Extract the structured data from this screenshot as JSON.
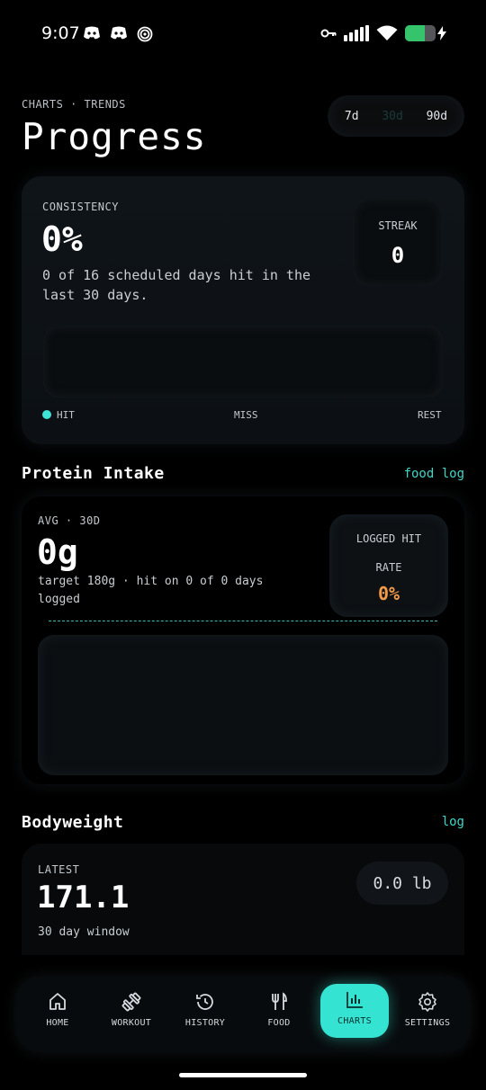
{
  "status_bar": {
    "time": "9:07",
    "left_icons": [
      "discord-icon",
      "discord-icon",
      "spiral-app-icon"
    ],
    "right_icons": [
      "key-icon",
      "signal-icon",
      "wifi-icon",
      "battery-icon"
    ],
    "battery_level": 0.65
  },
  "header": {
    "eyebrow": "CHARTS · TRENDS",
    "title": "Progress",
    "range_options": [
      "7d",
      "30d",
      "90d"
    ],
    "range_selected": "30d"
  },
  "consistency": {
    "label": "CONSISTENCY",
    "value": "0%",
    "description": "0 of 16 scheduled days hit in the last 30 days.",
    "streak_label": "STREAK",
    "streak_value": "0",
    "legend": {
      "hit": "HIT",
      "miss": "MISS",
      "rest": "REST"
    },
    "hit_color": "#3ee4d6"
  },
  "protein": {
    "section_title": "Protein Intake",
    "section_link": "food log",
    "label": "AVG · 30D",
    "value": "0g",
    "description": "target 180g · hit on 0 of 0 days logged",
    "rate_label_1": "LOGGED HIT",
    "rate_label_2": "RATE",
    "rate_value": "0%",
    "rate_color": "#f29a4a"
  },
  "bodyweight": {
    "section_title": "Bodyweight",
    "section_link": "log",
    "label": "LATEST",
    "value": "171.1",
    "description": "30 day window",
    "change": "0.0 lb"
  },
  "nav": {
    "items": [
      {
        "label": "HOME",
        "icon": "home-icon"
      },
      {
        "label": "WORKOUT",
        "icon": "dumbbell-icon"
      },
      {
        "label": "HISTORY",
        "icon": "history-icon"
      },
      {
        "label": "FOOD",
        "icon": "fork-knife-icon"
      },
      {
        "label": "CHARTS",
        "icon": "bar-chart-icon"
      },
      {
        "label": "SETTINGS",
        "icon": "gear-icon"
      }
    ],
    "active": "CHARTS",
    "accent": "#34e3d1"
  }
}
